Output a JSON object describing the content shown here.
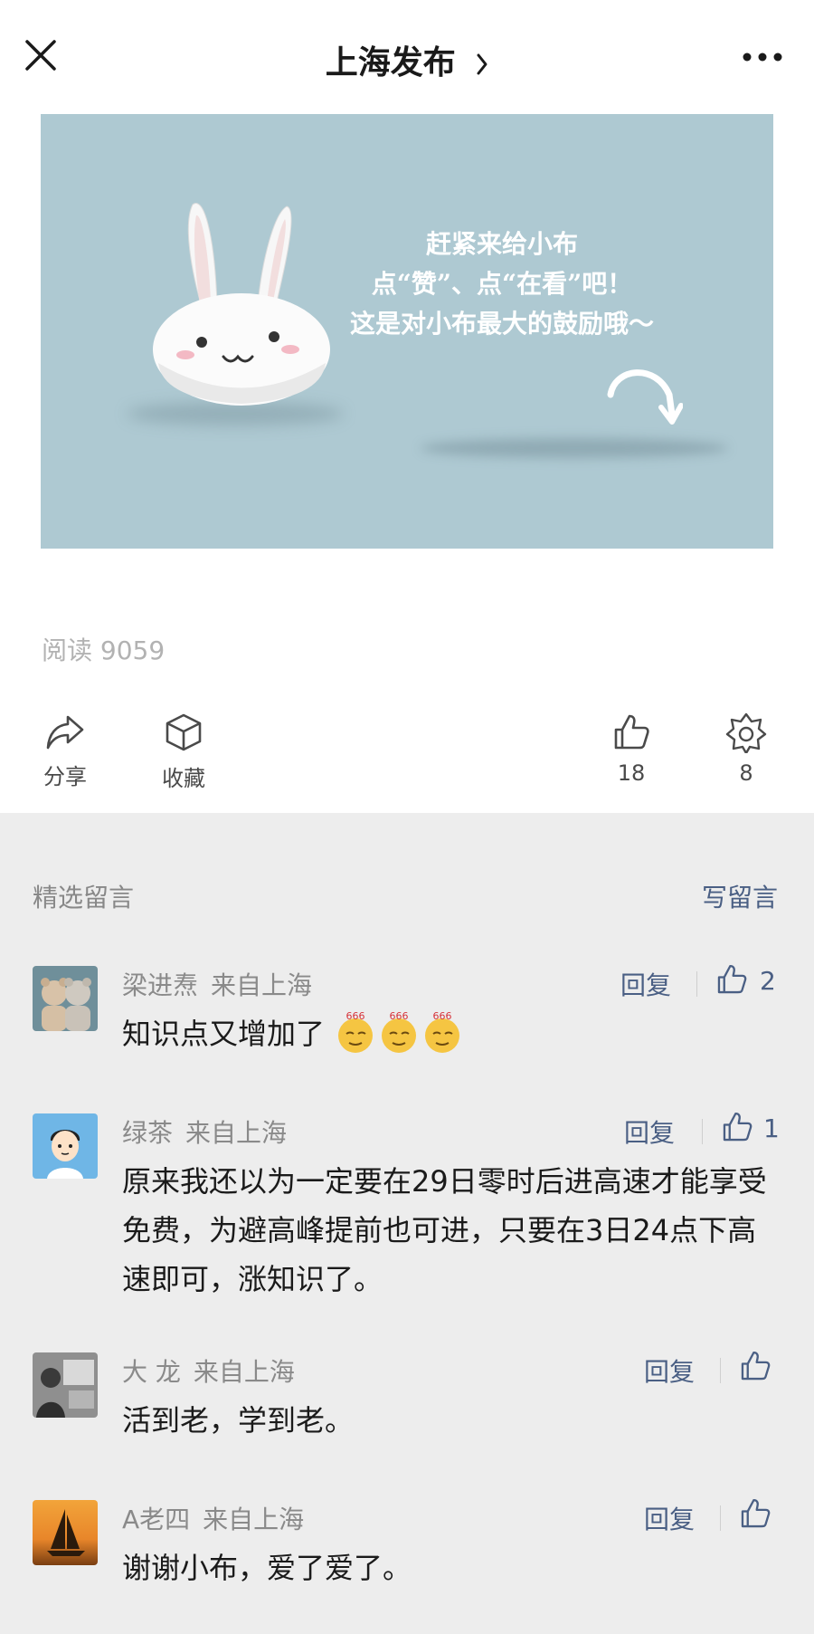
{
  "header": {
    "title": "上海发布"
  },
  "banner": {
    "line1": "赶紧来给小布",
    "line2": "点“赞”、点“在看”吧！",
    "line3": "这是对小布最大的鼓励哦～"
  },
  "read_count": "阅读 9059",
  "actions": {
    "share": "分享",
    "favorite": "收藏",
    "like_count": "18",
    "wow_count": "8"
  },
  "comments_section": {
    "title": "精选留言",
    "write_label": "写留言"
  },
  "comments": [
    {
      "name": "梁进焘",
      "location": "来自上海",
      "reply": "回复",
      "likes": "2",
      "text": "知识点又增加了",
      "emoji_label": "666"
    },
    {
      "name": "绿茶",
      "location": "来自上海",
      "reply": "回复",
      "likes": "1",
      "text": "原来我还以为一定要在29日零时后进高速才能享受免费，为避高峰提前也可进，只要在3日24点下高速即可，涨知识了。"
    },
    {
      "name": "大 龙",
      "location": "来自上海",
      "reply": "回复",
      "likes": "",
      "text": "活到老，学到老。"
    },
    {
      "name": "A老四",
      "location": "来自上海",
      "reply": "回复",
      "likes": "",
      "text": "谢谢小布，爱了爱了。"
    }
  ],
  "colors": {
    "link": "#4a5f84",
    "banner_bg": "#aec9d2",
    "page_bg": "#ededed"
  }
}
